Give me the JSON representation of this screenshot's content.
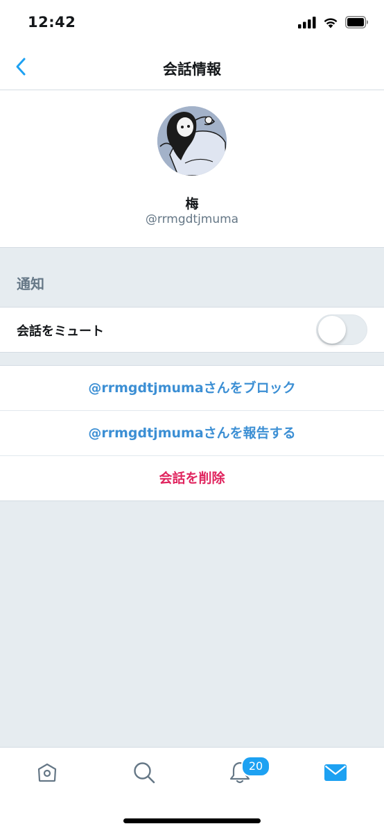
{
  "status_bar": {
    "time": "12:42"
  },
  "nav": {
    "title": "会話情報"
  },
  "profile": {
    "name": "梅",
    "handle": "@rrmgdtjmuma"
  },
  "notifications": {
    "header": "通知",
    "mute_label": "会話をミュート",
    "mute_enabled": false
  },
  "actions": {
    "block": "@rrmgdtjmumaさんをブロック",
    "report": "@rrmgdtjmumaさんを報告する",
    "delete": "会話を削除"
  },
  "tab_bar": {
    "tabs": [
      {
        "icon": "home-icon"
      },
      {
        "icon": "search-icon"
      },
      {
        "icon": "notifications-bell-icon",
        "badge": "20"
      },
      {
        "icon": "messages-envelope-icon",
        "active": true
      }
    ]
  },
  "colors": {
    "accent": "#1da1f2",
    "link": "#3c8fd4",
    "destructive": "#e0245e",
    "secondary_text": "#657786",
    "background": "#e6ecf0"
  }
}
